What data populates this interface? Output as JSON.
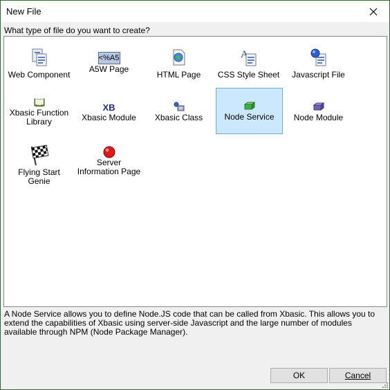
{
  "window": {
    "title": "New File"
  },
  "prompt": "What type of file do you want to create?",
  "file_types": [
    {
      "label": "Web Component",
      "icon": "web-component-icon",
      "selected": false
    },
    {
      "label": "A5W Page",
      "icon": "a5w-page-icon",
      "icon_text": "<%A5",
      "selected": false
    },
    {
      "label": "HTML Page",
      "icon": "html-page-icon",
      "selected": false
    },
    {
      "label": "CSS Style Sheet",
      "icon": "css-style-sheet-icon",
      "selected": false
    },
    {
      "label": "Javascript File",
      "icon": "javascript-file-icon",
      "selected": false
    },
    {
      "label": "Xbasic Function Library",
      "icon": "book-icon",
      "selected": false
    },
    {
      "label": "Xbasic Module",
      "icon": "xbasic-module-icon",
      "icon_text": "XB",
      "selected": false
    },
    {
      "label": "Xbasic Class",
      "icon": "xbasic-class-icon",
      "selected": false
    },
    {
      "label": "Node Service",
      "icon": "node-service-icon",
      "selected": true
    },
    {
      "label": "Node Module",
      "icon": "node-module-icon",
      "selected": false
    },
    {
      "label": "Flying Start Genie",
      "icon": "checkered-flag-icon",
      "selected": false
    },
    {
      "label": "Server Information Page",
      "icon": "red-ball-icon",
      "selected": false
    }
  ],
  "description": "A Node Service allows you to define Node.JS code that can be called from Xbasic. This allows you to extend the capabilities of Xbasic using server-side Javascript and the large number of modules available through NPM (Node Package Manager).",
  "buttons": {
    "ok": "OK",
    "cancel": "Cancel"
  },
  "colors": {
    "selection": "#cce8ff",
    "window_border": "#2b6e2b"
  }
}
